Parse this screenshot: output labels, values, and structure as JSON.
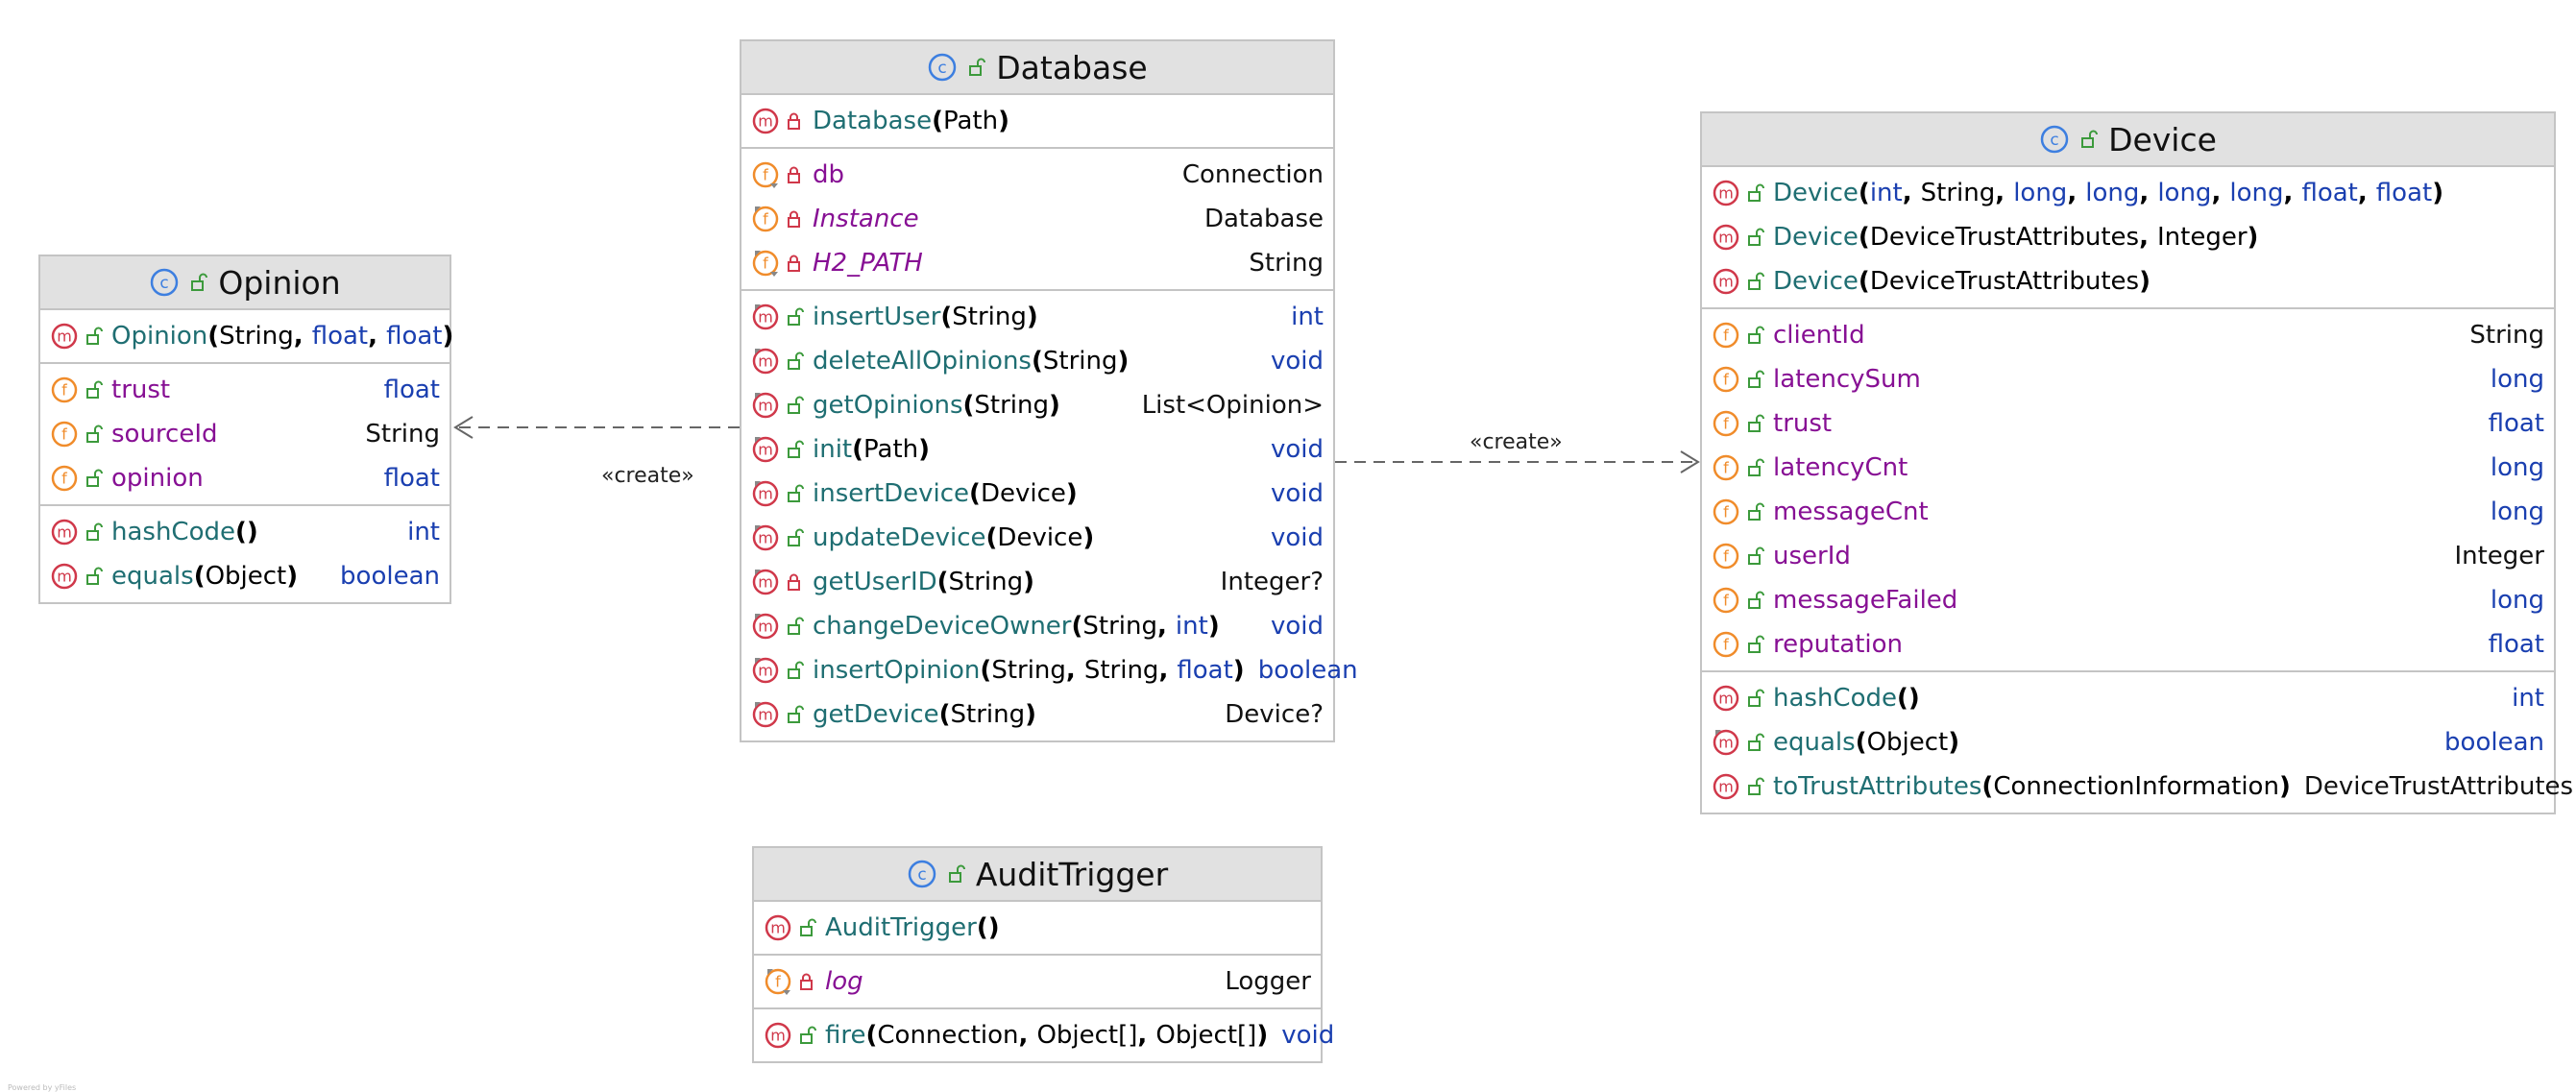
{
  "classes": [
    {
      "id": "opinion",
      "name": "Opinion",
      "visibility": "public",
      "methods_ctor": [
        {
          "name": "Opinion",
          "kind": "method",
          "vis": "public",
          "params": [
            {
              "t": "String",
              "kw": false
            },
            {
              "t": "float",
              "kw": true
            },
            {
              "t": "float",
              "kw": true
            }
          ],
          "type": "",
          "typeKw": false
        }
      ],
      "fields": [
        {
          "name": "trust",
          "kind": "field",
          "vis": "public",
          "type": "float",
          "typeKw": true
        },
        {
          "name": "sourceId",
          "kind": "field",
          "vis": "public",
          "type": "String",
          "typeKw": false
        },
        {
          "name": "opinion",
          "kind": "field",
          "vis": "public",
          "type": "float",
          "typeKw": true
        }
      ],
      "methods": [
        {
          "name": "hashCode",
          "kind": "method",
          "vis": "public",
          "params": [],
          "type": "int",
          "typeKw": true
        },
        {
          "name": "equals",
          "kind": "method",
          "vis": "public",
          "params": [
            {
              "t": "Object",
              "kw": false
            }
          ],
          "type": "boolean",
          "typeKw": true
        }
      ]
    },
    {
      "id": "database",
      "name": "Database",
      "visibility": "public",
      "methods_ctor": [
        {
          "name": "Database",
          "kind": "method",
          "vis": "private",
          "params": [
            {
              "t": "Path",
              "kw": false
            }
          ],
          "type": "",
          "typeKw": false
        }
      ],
      "fields": [
        {
          "name": "db",
          "kind": "field-final",
          "vis": "private",
          "type": "Connection",
          "typeKw": false
        },
        {
          "name": "Instance",
          "kind": "field-static",
          "vis": "private",
          "type": "Database",
          "typeKw": false,
          "italic": true
        },
        {
          "name": "H2_PATH",
          "kind": "field-static-final",
          "vis": "private",
          "type": "String",
          "typeKw": false,
          "italic": true
        }
      ],
      "methods": [
        {
          "name": "insertUser",
          "kind": "method-static",
          "vis": "public",
          "params": [
            {
              "t": "String",
              "kw": false
            }
          ],
          "type": "int",
          "typeKw": true
        },
        {
          "name": "deleteAllOpinions",
          "kind": "method-static",
          "vis": "public",
          "params": [
            {
              "t": "String",
              "kw": false
            }
          ],
          "type": "void",
          "typeKw": true
        },
        {
          "name": "getOpinions",
          "kind": "method-static",
          "vis": "public",
          "params": [
            {
              "t": "String",
              "kw": false
            }
          ],
          "type": "List<Opinion>",
          "typeKw": false
        },
        {
          "name": "init",
          "kind": "method-static",
          "vis": "public",
          "params": [
            {
              "t": "Path",
              "kw": false
            }
          ],
          "type": "void",
          "typeKw": true
        },
        {
          "name": "insertDevice",
          "kind": "method-static",
          "vis": "public",
          "params": [
            {
              "t": "Device",
              "kw": false
            }
          ],
          "type": "void",
          "typeKw": true
        },
        {
          "name": "updateDevice",
          "kind": "method-static",
          "vis": "public",
          "params": [
            {
              "t": "Device",
              "kw": false
            }
          ],
          "type": "void",
          "typeKw": true
        },
        {
          "name": "getUserID",
          "kind": "method-static",
          "vis": "private",
          "params": [
            {
              "t": "String",
              "kw": false
            }
          ],
          "type": "Integer?",
          "typeKw": false
        },
        {
          "name": "changeDeviceOwner",
          "kind": "method-static",
          "vis": "public",
          "params": [
            {
              "t": "String",
              "kw": false
            },
            {
              "t": "int",
              "kw": true
            }
          ],
          "type": "void",
          "typeKw": true
        },
        {
          "name": "insertOpinion",
          "kind": "method-static",
          "vis": "public",
          "params": [
            {
              "t": "String",
              "kw": false
            },
            {
              "t": "String",
              "kw": false
            },
            {
              "t": "float",
              "kw": true
            }
          ],
          "type": "boolean",
          "typeKw": true
        },
        {
          "name": "getDevice",
          "kind": "method-static",
          "vis": "public",
          "params": [
            {
              "t": "String",
              "kw": false
            }
          ],
          "type": "Device?",
          "typeKw": false
        }
      ]
    },
    {
      "id": "device",
      "name": "Device",
      "visibility": "public",
      "methods_ctor": [
        {
          "name": "Device",
          "kind": "method",
          "vis": "public",
          "params": [
            {
              "t": "int",
              "kw": true
            },
            {
              "t": "String",
              "kw": false
            },
            {
              "t": "long",
              "kw": true
            },
            {
              "t": "long",
              "kw": true
            },
            {
              "t": "long",
              "kw": true
            },
            {
              "t": "long",
              "kw": true
            },
            {
              "t": "float",
              "kw": true
            },
            {
              "t": "float",
              "kw": true
            }
          ],
          "type": "",
          "typeKw": false
        },
        {
          "name": "Device",
          "kind": "method",
          "vis": "public",
          "params": [
            {
              "t": "DeviceTrustAttributes",
              "kw": false
            },
            {
              "t": "Integer",
              "kw": false
            }
          ],
          "type": "",
          "typeKw": false
        },
        {
          "name": "Device",
          "kind": "method",
          "vis": "public",
          "params": [
            {
              "t": "DeviceTrustAttributes",
              "kw": false
            }
          ],
          "type": "",
          "typeKw": false
        }
      ],
      "fields": [
        {
          "name": "clientId",
          "kind": "field",
          "vis": "public",
          "type": "String",
          "typeKw": false
        },
        {
          "name": "latencySum",
          "kind": "field",
          "vis": "public",
          "type": "long",
          "typeKw": true
        },
        {
          "name": "trust",
          "kind": "field",
          "vis": "public",
          "type": "float",
          "typeKw": true
        },
        {
          "name": "latencyCnt",
          "kind": "field",
          "vis": "public",
          "type": "long",
          "typeKw": true
        },
        {
          "name": "messageCnt",
          "kind": "field",
          "vis": "public",
          "type": "long",
          "typeKw": true
        },
        {
          "name": "userId",
          "kind": "field",
          "vis": "public",
          "type": "Integer",
          "typeKw": false
        },
        {
          "name": "messageFailed",
          "kind": "field",
          "vis": "public",
          "type": "long",
          "typeKw": true
        },
        {
          "name": "reputation",
          "kind": "field",
          "vis": "public",
          "type": "float",
          "typeKw": true
        }
      ],
      "methods": [
        {
          "name": "hashCode",
          "kind": "method",
          "vis": "public",
          "params": [],
          "type": "int",
          "typeKw": true
        },
        {
          "name": "equals",
          "kind": "method-static",
          "vis": "public",
          "params": [
            {
              "t": "Object",
              "kw": false
            }
          ],
          "type": "boolean",
          "typeKw": true
        },
        {
          "name": "toTrustAttributes",
          "kind": "method",
          "vis": "public",
          "params": [
            {
              "t": "ConnectionInformation",
              "kw": false
            }
          ],
          "type": "DeviceTrustAttributes",
          "typeKw": false
        }
      ]
    },
    {
      "id": "audittrigger",
      "name": "AuditTrigger",
      "visibility": "public",
      "methods_ctor": [
        {
          "name": "AuditTrigger",
          "kind": "method",
          "vis": "public",
          "params": [],
          "type": "",
          "typeKw": false
        }
      ],
      "fields": [
        {
          "name": "log",
          "kind": "field-static-final",
          "vis": "private",
          "type": "Logger",
          "typeKw": false,
          "italic": true
        }
      ],
      "methods": [
        {
          "name": "fire",
          "kind": "method",
          "vis": "public",
          "params": [
            {
              "t": "Connection",
              "kw": false
            },
            {
              "t": "Object[]",
              "kw": false
            },
            {
              "t": "Object[]",
              "kw": false
            }
          ],
          "type": "void",
          "typeKw": true
        }
      ]
    }
  ],
  "relations": [
    {
      "from": "database",
      "to": "opinion",
      "label": "«create»"
    },
    {
      "from": "database",
      "to": "device",
      "label": "«create»"
    }
  ],
  "watermark": "Powered by yFiles",
  "colors": {
    "method_icon": "#d0384a",
    "field_icon": "#f08c2b",
    "class_icon": "#3d7fe0",
    "public_lock": "#3c9a3c",
    "private_lock": "#d0384a",
    "keyword": "#1a3fb0",
    "method_name": "#1f6e72",
    "field_name": "#871094",
    "header_bg": "#e1e1e1",
    "border": "#c4c4c4"
  }
}
